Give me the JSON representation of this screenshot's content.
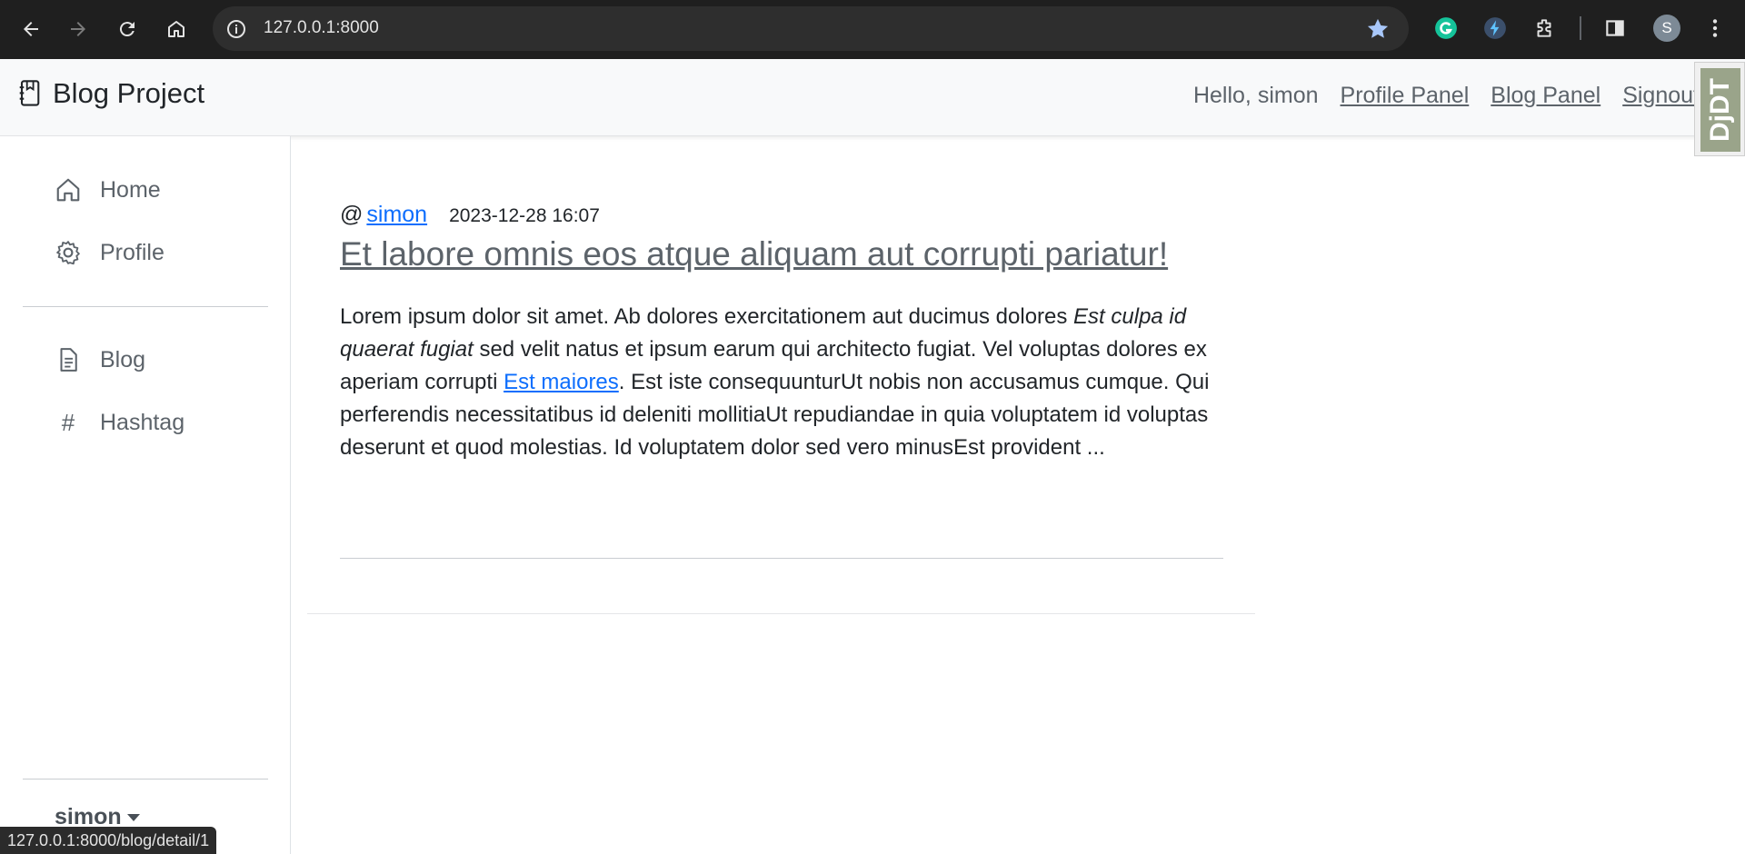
{
  "browser": {
    "url": "127.0.0.1:8000",
    "avatar_letter": "S",
    "status_url": "127.0.0.1:8000/blog/detail/1"
  },
  "navbar": {
    "brand": "Blog Project",
    "greeting": "Hello, simon",
    "links": [
      "Profile Panel",
      "Blog Panel",
      "Signout"
    ],
    "debug_toolbar_label": "DjDT"
  },
  "sidebar": {
    "items": [
      {
        "label": "Home",
        "icon": "house-icon"
      },
      {
        "label": "Profile",
        "icon": "gear-icon"
      },
      {
        "label": "Blog",
        "icon": "document-icon"
      },
      {
        "label": "Hashtag",
        "icon": "hash-icon",
        "glyph": "#"
      }
    ],
    "user": "simon"
  },
  "post": {
    "at_symbol": "@",
    "author": "simon",
    "date": "2023-12-28 16:07",
    "title": "Et labore omnis eos atque aliquam aut corrupti pariatur!",
    "body_part1": "Lorem ipsum dolor sit amet. Ab dolores exercitationem aut ducimus dolores ",
    "body_italic": "Est culpa id quaerat fugiat",
    "body_part2": " sed velit natus et ipsum earum qui architecto fugiat. Vel voluptas dolores ex aperiam corrupti ",
    "body_link": "Est maiores",
    "body_part3": ". Est iste consequunturUt nobis non accusamus cumque. Qui perferendis necessitatibus id deleniti mollitiaUt repudiandae in quia voluptatem id voluptas deserunt et quod molestias. Id voluptatem dolor sed vero minusEst provident ..."
  },
  "colors": {
    "link": "#0d6efd",
    "chrome_bg": "#1f1f1f",
    "navbar_bg": "#f8f9fa"
  }
}
